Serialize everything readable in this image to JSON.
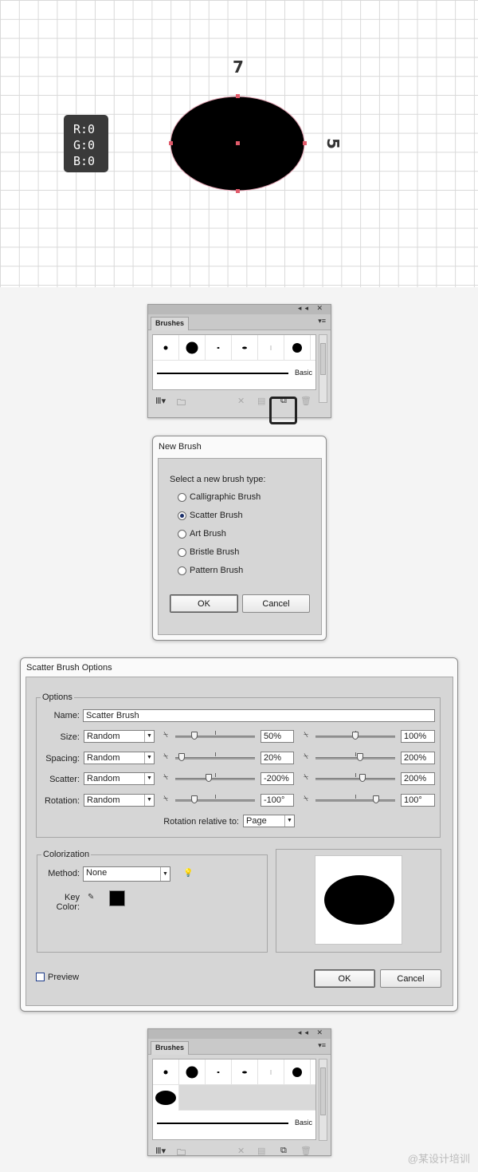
{
  "artboard": {
    "rgb": {
      "r": "R:0",
      "g": "G:0",
      "b": "B:0"
    },
    "width_label": "7",
    "height_label": "5"
  },
  "brushes_top": {
    "tab": "Brushes",
    "basic_label": "Basic"
  },
  "new_brush": {
    "title": "New Brush",
    "prompt": "Select a new brush type:",
    "options": [
      "Calligraphic Brush",
      "Scatter Brush",
      "Art Brush",
      "Bristle Brush",
      "Pattern Brush"
    ],
    "selected": "Scatter Brush",
    "ok": "OK",
    "cancel": "Cancel"
  },
  "scatter": {
    "title": "Scatter Brush Options",
    "options_group": "Options",
    "name_label": "Name:",
    "name_value": "Scatter Brush",
    "rows": [
      {
        "label": "Size:",
        "mode": "Random",
        "min": "50%",
        "max": "100%"
      },
      {
        "label": "Spacing:",
        "mode": "Random",
        "min": "20%",
        "max": "200%"
      },
      {
        "label": "Scatter:",
        "mode": "Random",
        "min": "-200%",
        "max": "200%"
      },
      {
        "label": "Rotation:",
        "mode": "Random",
        "min": "-100°",
        "max": "100°"
      }
    ],
    "rotation_relative_label": "Rotation relative to:",
    "rotation_relative_value": "Page",
    "colorization_group": "Colorization",
    "method_label": "Method:",
    "method_value": "None",
    "key_color_label": "Key Color:",
    "key_color": "#000000",
    "preview_label": "Preview",
    "ok": "OK",
    "cancel": "Cancel"
  },
  "brushes_bottom": {
    "tab": "Brushes",
    "basic_label": "Basic"
  },
  "watermark": "@某设计培训"
}
